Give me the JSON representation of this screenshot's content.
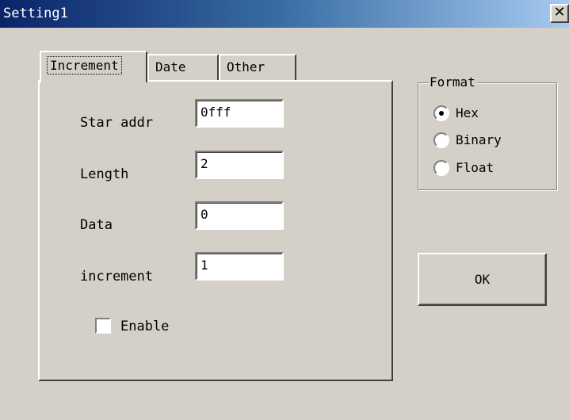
{
  "window": {
    "title": "Setting1",
    "close_glyph": "✕"
  },
  "tabs": [
    {
      "label": "Increment",
      "active": true
    },
    {
      "label": "Date",
      "active": false
    },
    {
      "label": "Other",
      "active": false
    }
  ],
  "fields": {
    "start_addr": {
      "label": "Star addr",
      "value": "0fff"
    },
    "length": {
      "label": "Length",
      "value": "2"
    },
    "data": {
      "label": "Data",
      "value": "0"
    },
    "increment": {
      "label": "increment",
      "value": "1"
    }
  },
  "enable": {
    "label": "Enable",
    "checked": false
  },
  "format": {
    "title": "Format",
    "options": [
      {
        "label": "Hex",
        "selected": true
      },
      {
        "label": "Binary",
        "selected": false
      },
      {
        "label": "Float",
        "selected": false
      }
    ]
  },
  "ok_button": {
    "label": "OK"
  },
  "colors": {
    "face": "#d4d0c8",
    "title_gradient_start": "#0a246a",
    "title_gradient_end": "#a6caf0"
  }
}
